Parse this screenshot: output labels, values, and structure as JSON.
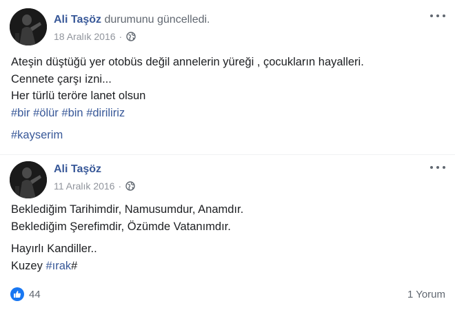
{
  "posts": [
    {
      "author": "Ali Taşöz",
      "action": "durumunu güncelledi.",
      "date": "18 Aralık 2016",
      "separator": "·",
      "privacy_icon": "globe-icon",
      "lines": [
        "Ateşin düştüğü yer otobüs değil annelerin yüreği , çocukların hayalleri.",
        "Cennete çarşı izni...",
        "Her türlü teröre lanet olsun"
      ],
      "hashtags_line": [
        "#bir",
        "#ölür",
        "#bin",
        "#diriliriz"
      ],
      "extra_hashtag": "#kayserim"
    },
    {
      "author": "Ali Taşöz",
      "date": "11 Aralık 2016",
      "separator": "·",
      "privacy_icon": "globe-icon",
      "paragraph1": [
        "Beklediğim Tarihimdir, Namusumdur, Anamdır.",
        "Beklediğim Şerefimdir, Özümde Vatanımdır."
      ],
      "paragraph2_line1": "Hayırlı Kandiller..",
      "paragraph2_line2_prefix": "Kuzey ",
      "paragraph2_hashtag": "#ırak",
      "paragraph2_suffix": "#",
      "likes": "44",
      "comments": "1 Yorum"
    }
  ],
  "icons": {
    "more": "more-options-icon",
    "like": "like-thumb-icon"
  },
  "colors": {
    "link": "#385898",
    "text": "#1c1e21",
    "meta": "#90949c",
    "like_blue": "#1877f2"
  }
}
